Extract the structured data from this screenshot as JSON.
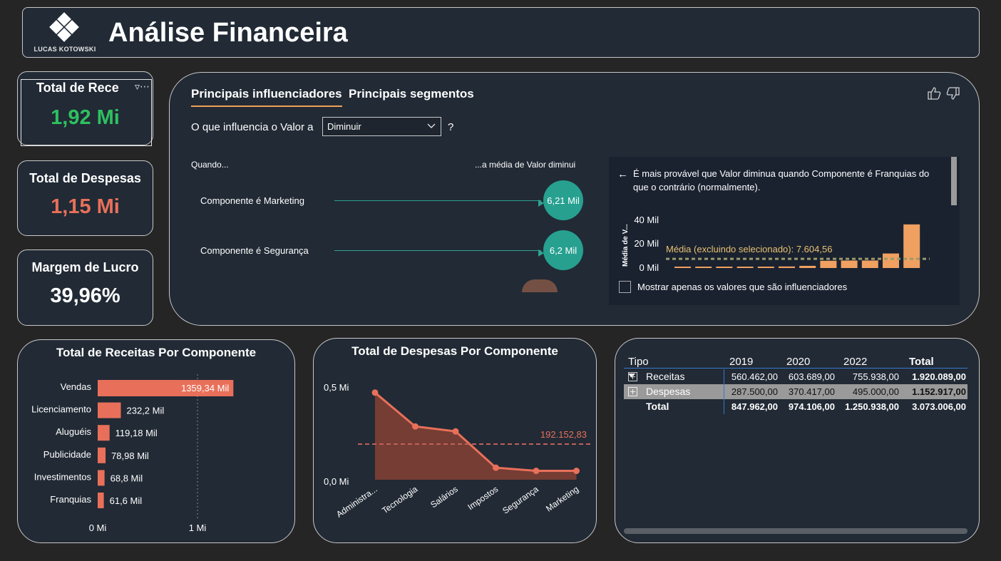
{
  "header": {
    "logo_text": "LUCAS KOTOWSKI",
    "title": "Análise Financeira"
  },
  "kpis": {
    "receitas": {
      "label": "Total de Rece",
      "value": "1,92 Mi",
      "color": "#2ec060"
    },
    "despesas": {
      "label": "Total de Despesas",
      "value": "1,15 Mi",
      "color": "#e8705a"
    },
    "margem": {
      "label": "Margem de Lucro",
      "value": "39,96%",
      "color": "#ffffff"
    }
  },
  "key_influencers": {
    "tab_influencers": "Principais influenciadores",
    "tab_segments": "Principais segmentos",
    "question_prefix": "O que influencia o Valor a",
    "dropdown_value": "Diminuir",
    "question_suffix": "?",
    "when_label": "Quando...",
    "mean_label": "...a média de Valor diminui",
    "influencers": [
      {
        "label": "Componente é Marketing",
        "value": "6,21 Mil"
      },
      {
        "label": "Componente é Segurança",
        "value": "6,2 Mil"
      }
    ],
    "detail": {
      "text": "É mais provável que Valor diminua quando Componente é Franquias do que o contrário (normalmente).",
      "y_axis_label": "Média de V...",
      "y_ticks": [
        "40 Mil",
        "20 Mil",
        "0 Mil"
      ],
      "average_label": "Média (excluindo selecionado): 7.604,56",
      "checkbox_label": "Mostrar apenas os valores que são influenciadores"
    }
  },
  "bar_chart": {
    "title": "Total de Receitas Por Componente",
    "x_ticks": [
      "0 Mi",
      "1 Mi"
    ]
  },
  "line_chart": {
    "title": "Total de Despesas Por Componente",
    "y_ticks": [
      "0,5 Mi",
      "0,0 Mi"
    ],
    "ref_label": "192.152,83"
  },
  "chart_data": [
    {
      "type": "bar",
      "title": "Total de Receitas Por Componente",
      "orientation": "horizontal",
      "categories": [
        "Vendas",
        "Licenciamento",
        "Aluguéis",
        "Publicidade",
        "Investimentos",
        "Franquias"
      ],
      "values": [
        1359.34,
        232.2,
        119.18,
        78.98,
        68.8,
        61.6
      ],
      "value_labels": [
        "1359,34 Mil",
        "232,2 Mil",
        "119,18 Mil",
        "78,98 Mil",
        "68,8 Mil",
        "61,6 Mil"
      ],
      "unit": "Mil",
      "xlim": [
        0,
        1200
      ],
      "color": "#e8705a"
    },
    {
      "type": "area",
      "title": "Total de Despesas Por Componente",
      "categories": [
        "Administra...",
        "Tecnologia",
        "Salários",
        "Impostos",
        "Segurança",
        "Marketing"
      ],
      "values": [
        470000,
        287500,
        261000,
        65000,
        48000,
        48000
      ],
      "reference_line": 192152.83,
      "ylim": [
        0,
        500000
      ],
      "color": "#e8705a"
    },
    {
      "type": "bar",
      "title": "",
      "categories": [
        "c1",
        "c2",
        "c3",
        "c4",
        "c5",
        "c6",
        "c7",
        "c8",
        "c9",
        "c10",
        "c11",
        "c12"
      ],
      "values": [
        500,
        600,
        700,
        900,
        1000,
        1300,
        1800,
        6000,
        6200,
        6210,
        12000,
        36000
      ],
      "average": 7604.56,
      "ylim": [
        0,
        40000
      ],
      "color": "#f0a060"
    }
  ],
  "matrix": {
    "columns": [
      "Tipo",
      "2019",
      "2020",
      "2022",
      "Total"
    ],
    "rows": [
      {
        "label": "Receitas",
        "values": [
          "560.462,00",
          "603.689,00",
          "755.938,00",
          "1.920.089,00"
        ]
      },
      {
        "label": "Despesas",
        "values": [
          "287.500,00",
          "370.417,00",
          "495.000,00",
          "1.152.917,00"
        ]
      },
      {
        "label": "Total",
        "values": [
          "847.962,00",
          "974.106,00",
          "1.250.938,00",
          "3.073.006,00"
        ]
      }
    ]
  }
}
